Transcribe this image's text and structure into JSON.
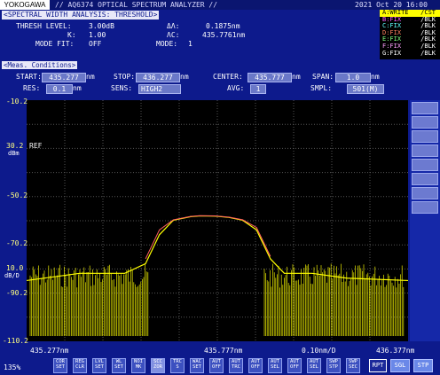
{
  "brand": "YOKOGAWA",
  "app_title": "// AQ6374 OPTICAL SPECTRUM ANALYZER //",
  "datetime": "2021 Oct 20 16:00",
  "analysis": {
    "header": "<SPECTRAL WIDTH ANALYSIS: THRESHOLD>",
    "thresh_label": "THRESH LEVEL:",
    "thresh_value": "3.00dB",
    "k_label": "K:",
    "k_value": "1.00",
    "mode_fit_label": "MODE FIT:",
    "mode_fit_value": "OFF",
    "dl_label": "ΔΛ:",
    "dl_value": "0.1875nm",
    "lc_label": "ΛC:",
    "lc_value": "435.7761nm",
    "mode_label": "MODE:",
    "mode_value": "1"
  },
  "traces": [
    {
      "name": "A:WRITE",
      "mode": "/CST",
      "color": "#ffff00",
      "active": true
    },
    {
      "name": "B:FIX",
      "mode": "/BLK",
      "color": "#ff60ff"
    },
    {
      "name": "C:FIX",
      "mode": "/BLK",
      "color": "#60ffff"
    },
    {
      "name": "D:FIX",
      "mode": "/BLK",
      "color": "#ff8060"
    },
    {
      "name": "E:FIX",
      "mode": "/BLK",
      "color": "#80ff80"
    },
    {
      "name": "F:FIX",
      "mode": "/BLK",
      "color": "#ffa0ff"
    },
    {
      "name": "G:FIX",
      "mode": "/BLK",
      "color": "#ffffff"
    }
  ],
  "meas": {
    "header": "<Meas. Conditions>",
    "start_label": "START:",
    "start_value": "435.277",
    "start_unit": "nm",
    "stop_label": "STOP:",
    "stop_value": "436.277",
    "stop_unit": "nm",
    "center_label": "CENTER:",
    "center_value": "435.777",
    "center_unit": "nm",
    "span_label": "SPAN:",
    "span_value": "1.0",
    "span_unit": "nm",
    "res_label": "RES:",
    "res_value": "0.1",
    "res_unit": "nm",
    "sens_label": "SENS:",
    "sens_value": "HIGH2",
    "avg_label": "AVG:",
    "avg_value": "1",
    "smpl_label": "SMPL:",
    "smpl_value": "501(M)"
  },
  "y_labels": [
    "-10.2",
    "30.2",
    "dBm",
    "-50.2",
    "-70.2",
    "10.0",
    "dB/D",
    "-90.2",
    "-110.2"
  ],
  "ref_label": "REF",
  "x_labels": {
    "left": "435.277nm",
    "center": "435.777nm",
    "span_div": "0.10nm/D",
    "right": "436.377nm"
  },
  "bottom": {
    "percent": "135%",
    "buttons": [
      "COR SET",
      "REG CLR",
      "LVL SET",
      "WL SET",
      "NOI MK",
      "SCC ZOR",
      "TRC S",
      "WAC SET",
      "AUT OFF",
      "AUT TRC",
      "AUT OFF",
      "AUT SEL",
      "AUT OFF",
      "AUT SEL",
      "SWP STP",
      "SWP SEC"
    ],
    "rpt_label": "RPT",
    "sgl_label": "SGL",
    "stp_label": "STP"
  },
  "chart_data": {
    "type": "line",
    "xlabel": "",
    "ylabel": "",
    "xlim": [
      435.277,
      436.377
    ],
    "ylim": [
      -110.2,
      -10.2
    ],
    "series": [
      {
        "color": "#ffff00",
        "x": [
          435.277,
          435.43,
          435.56,
          435.62,
          435.66,
          435.7,
          435.75,
          435.777,
          435.82,
          435.86,
          435.9,
          435.94,
          435.98,
          436.02,
          436.1,
          436.2,
          436.377
        ],
        "y": [
          -85,
          -82,
          -82,
          -78,
          -66,
          -60,
          -58.5,
          -58.2,
          -58.3,
          -58.8,
          -60,
          -64,
          -76,
          -82,
          -82,
          -84,
          -85
        ]
      },
      {
        "color": "#ff6060",
        "x": [
          435.62,
          435.66,
          435.7,
          435.75,
          435.777,
          435.82,
          435.86,
          435.9,
          435.94,
          435.98
        ],
        "y": [
          -76,
          -64,
          -59.8,
          -58.4,
          -58.1,
          -58.2,
          -58.7,
          -59.8,
          -63,
          -75
        ]
      }
    ]
  }
}
